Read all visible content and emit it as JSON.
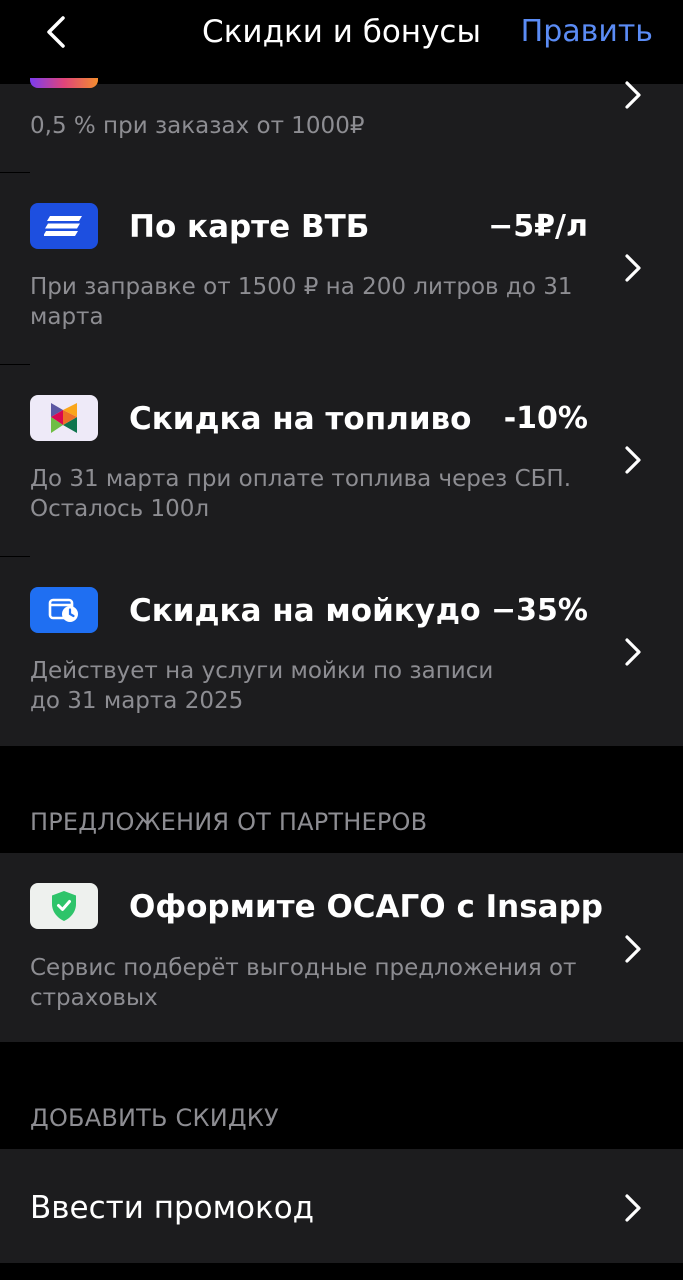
{
  "header": {
    "title": "Скидки и бонусы",
    "edit_label": "Править"
  },
  "discounts": [
    {
      "description": "0,5 % при заказах от 1000₽",
      "icon": "gradient-badge-icon"
    },
    {
      "title": "По карте ВТБ",
      "value": "−5₽/л",
      "description": "При заправке от 1500 ₽ на 200 литров до 31 марта",
      "icon": "vtb-card-icon",
      "icon_color": "#1d4fe0"
    },
    {
      "title": "Скидка на топливо",
      "value": "-10%",
      "description": "До 31 марта при оплате топлива через СБП. Осталось 100л",
      "icon": "sbp-logo-icon",
      "icon_color": "#eeeaf8"
    },
    {
      "title": "Скидка на мойку",
      "value": "до −35%",
      "description": "Действует на услуги мойки по записи до 31 марта 2025",
      "icon": "car-wash-clock-icon",
      "icon_color": "#1f6ff2"
    }
  ],
  "partners": {
    "header": "ПРЕДЛОЖЕНИЯ ОТ ПАРТНЕРОВ",
    "items": [
      {
        "title": "Оформите ОСАГО с Insapp",
        "description": "Сервис подберёт выгодные предложения от страховых",
        "icon": "shield-check-icon",
        "icon_color": "#eef1ee"
      }
    ]
  },
  "add_discount": {
    "header": "ДОБАВИТЬ СКИДКУ",
    "promo_label": "Ввести промокод"
  },
  "colors": {
    "accent": "#5b8cf5",
    "card_bg": "#1c1c1e",
    "secondary_text": "#8d8d92",
    "shield_green": "#2ec46a"
  }
}
